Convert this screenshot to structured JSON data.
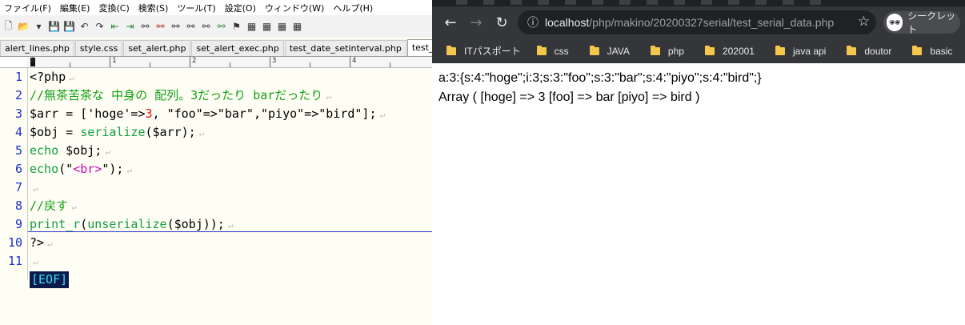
{
  "editor": {
    "menu": [
      "ファイル(F)",
      "編集(E)",
      "変換(C)",
      "検索(S)",
      "ツール(T)",
      "設定(O)",
      "ウィンドウ(W)",
      "ヘルプ(H)"
    ],
    "tabs": [
      "alert_lines.php",
      "style.css",
      "set_alert.php",
      "set_alert_exec.php",
      "test_date_setinterval.php",
      "test_serial_d"
    ],
    "active_tab_index": 5,
    "ruler_ticks": [
      "0",
      "1",
      "2",
      "3",
      "4"
    ],
    "line_numbers": [
      "1",
      "2",
      "3",
      "4",
      "5",
      "6",
      "7",
      "8",
      "9",
      "10",
      "11"
    ],
    "code": {
      "l1": "<?php",
      "l2": "//無茶苦茶な 中身の 配列。3だったり barだったり",
      "l3_a": "$arr = ['hoge'=>",
      "l3_num": "3",
      "l3_b": ", \"foo\"=>\"bar\",\"piyo\"=>\"bird\"];",
      "l4_a": "$obj = ",
      "l4_fn": "serialize",
      "l4_b": "($arr);",
      "l5_kw": "echo",
      "l5_b": " $obj;",
      "l6_kw": "echo",
      "l6_a": "(\"",
      "l6_tag": "<br>",
      "l6_b": "\");",
      "l8": "//戻す",
      "l9_fn1": "print_r",
      "l9_a": "(",
      "l9_fn2": "unserialize",
      "l9_b": "($obj));",
      "l10": "?>",
      "eof": "[EOF]"
    },
    "eol_mark": "↵"
  },
  "browser": {
    "url_host": "localhost",
    "url_path": "/php/makino/20200327serial/test_serial_data.php",
    "incognito_label": "シークレット",
    "bookmarks": [
      "ITパスポート",
      "css",
      "JAVA",
      "php",
      "202001",
      "java api",
      "doutor",
      "basic"
    ],
    "output_line1": "a:3:{s:4:\"hoge\";i:3;s:3:\"foo\";s:3:\"bar\";s:4:\"piyo\";s:4:\"bird\";}",
    "output_line2": "Array ( [hoge] => 3 [foo] => bar [piyo] => bird )"
  },
  "colors": {
    "line_number": "#1d2fd1",
    "comment": "#14a014",
    "function": "#10a040",
    "number": "#e01010",
    "html_tag": "#d000c0",
    "chrome_bar": "#35363a",
    "folder": "#f4c64b"
  }
}
